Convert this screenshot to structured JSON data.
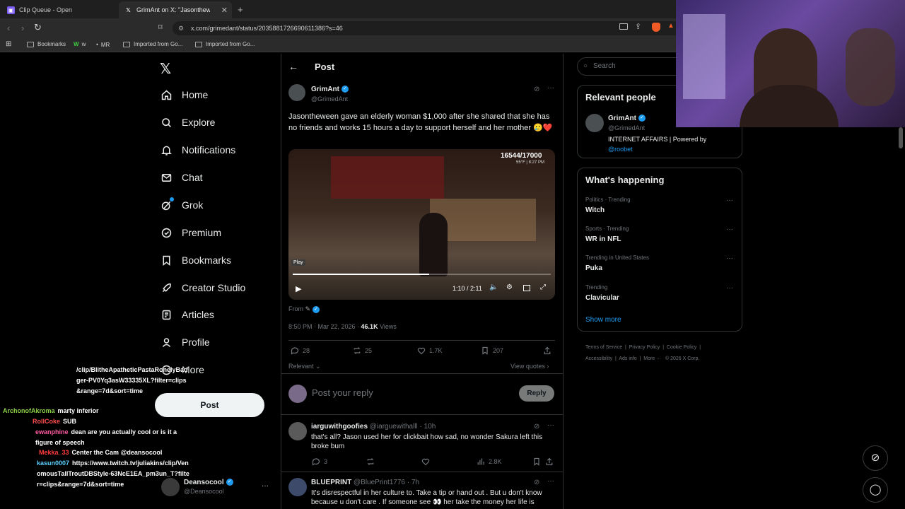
{
  "browser": {
    "tabs": [
      {
        "title": "Clip Queue - Open",
        "active": false
      },
      {
        "title": "GrimAnt on X: \"Jasontheween",
        "active": true
      }
    ],
    "url": "x.com/grimedant/status/2035881726690611386?s=46",
    "bookmarks": [
      "Bookmarks",
      "w",
      "MR",
      "Imported from Go...",
      "Imported from Go..."
    ]
  },
  "nav": {
    "items": [
      {
        "label": "Home",
        "icon": "home-icon"
      },
      {
        "label": "Explore",
        "icon": "search-icon"
      },
      {
        "label": "Notifications",
        "icon": "bell-icon"
      },
      {
        "label": "Chat",
        "icon": "mail-icon"
      },
      {
        "label": "Grok",
        "icon": "grok-icon"
      },
      {
        "label": "Premium",
        "icon": "premium-icon"
      },
      {
        "label": "Bookmarks",
        "icon": "bookmark-icon"
      },
      {
        "label": "Creator Studio",
        "icon": "rocket-icon"
      },
      {
        "label": "Articles",
        "icon": "article-icon"
      },
      {
        "label": "Profile",
        "icon": "person-icon"
      },
      {
        "label": "More",
        "icon": "more-icon"
      }
    ],
    "post_label": "Post",
    "account": {
      "name": "Deansocool",
      "handle": "@Deansocool"
    }
  },
  "post": {
    "header_title": "Post",
    "author_name": "GrimAnt",
    "author_handle": "@GrimedAnt",
    "text": "Jasontheween gave an elderly woman $1,000 after she shared that she has no friends and works 15 hours a day to support herself and her mother 🥲❤️",
    "video": {
      "overlay_count": "16544/17000",
      "overlay_weather": "55°F | 8:27 PM",
      "tooltip": "Play",
      "time": "1:10 / 2:11",
      "progress": 0.53
    },
    "from_label": "From",
    "timestamp": "8:50 PM · Mar 22, 2026 · ",
    "views_count": "46.1K",
    "views_label": " Views",
    "stats": {
      "replies": "28",
      "reposts": "25",
      "likes": "1.7K",
      "bookmarks": "207"
    },
    "relevant_label": "Relevant",
    "view_quotes_label": "View quotes",
    "reply_placeholder": "Post your reply",
    "reply_button": "Reply"
  },
  "replies": [
    {
      "name": "iarguwithgoofies",
      "handle": "@iarguewithalll",
      "time": "10h",
      "text": "that's all? Jason used her for clickbait how sad, no wonder Sakura left this broke bum",
      "replies": "3",
      "views": "2.8K"
    },
    {
      "name": "BLUEPRINT",
      "handle": "@BluePrint1776",
      "time": "7h",
      "text": "It's disrespectful in her culture  to. Take a tip or hand out . But u don't know because u don't care . If someone see 👀  her take the money  her life is"
    }
  ],
  "sidebar": {
    "search_placeholder": "Search",
    "relevant_title": "Relevant people",
    "person": {
      "name": "GrimAnt",
      "handle": "@GrimedAnt",
      "bio": "INTERNET AFFAIRS | Powered by",
      "bio_link": "@roobet"
    },
    "happening_title": "What's happening",
    "trends": [
      {
        "meta": "Politics · Trending",
        "name": "Witch"
      },
      {
        "meta": "Sports · Trending",
        "name": "WR in NFL"
      },
      {
        "meta": "Trending in United States",
        "name": "Puka"
      },
      {
        "meta": "Trending",
        "name": "Clavicular"
      }
    ],
    "show_more": "Show more",
    "footer": [
      "Terms of Service",
      "Privacy Policy",
      "Cookie Policy",
      "Accessibility",
      "Ads info",
      "More ···",
      "© 2026 X Corp."
    ]
  },
  "chat": {
    "lines": [
      {
        "user": "",
        "msg": "/clip/BlitheApatheticPastaRonelyBadger-PV0Yq3asW33335XL?filter=clips&range=7d&sort=time",
        "color": "#ffffff"
      },
      {
        "user": "ArchonofAkroma",
        "msg": "marty inferior",
        "color": "#8dd14a"
      },
      {
        "user": "RollCoke",
        "msg": "SUB",
        "color": "#ff4d4d"
      },
      {
        "user": "ewanphine",
        "msg": "dean are you actually cool or is it a figure of speech",
        "color": "#ff5aa0"
      },
      {
        "user": "Mekka_33",
        "msg": "Center the Cam @deansocool",
        "color": "#ff3b3b"
      },
      {
        "user": "kasun0007",
        "msg": "https://www.twitch.tv/juliakins/clip/VenomousTallTroutDBStyle-63NcE1EA_pm3un_T?filter=clips&range=7d&sort=time",
        "color": "#5ad1ff"
      }
    ]
  },
  "colors": {
    "accent": "#1d9bf0",
    "background": "#000000",
    "border": "#2f3336",
    "muted": "#71767b"
  }
}
